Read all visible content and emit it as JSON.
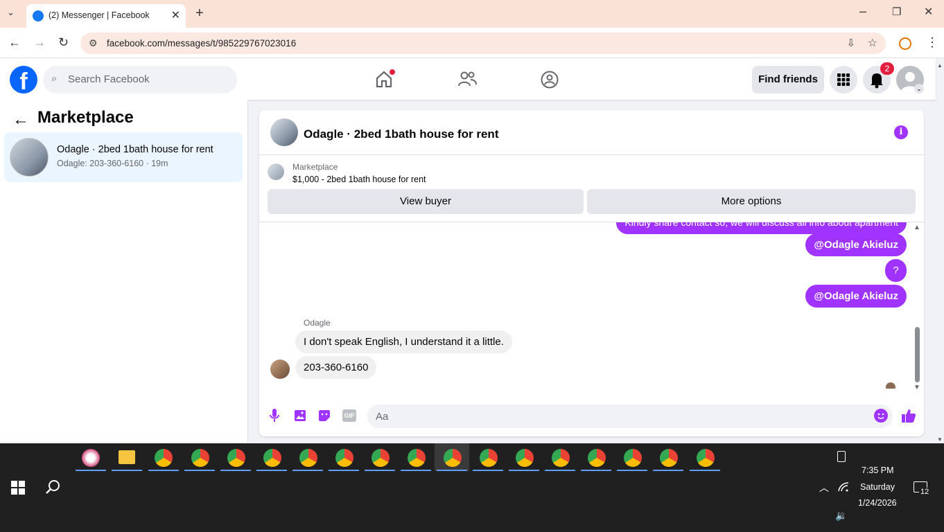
{
  "browser": {
    "tab_title": "(2) Messenger | Facebook",
    "url": "facebook.com/messages/t/985229767023016"
  },
  "header": {
    "search_placeholder": "Search Facebook",
    "find_friends": "Find friends",
    "notification_count": "2"
  },
  "left_panel": {
    "title": "Marketplace",
    "conversation": {
      "name": "Odagle · 2bed 1bath house for rent",
      "preview": "Odagle: 203-360-6160 · 19m"
    }
  },
  "chat": {
    "title": "Odagle · 2bed 1bath house for rent",
    "marketplace_label": "Marketplace",
    "listing": "$1,000 - 2bed 1bath house for rent",
    "view_buyer": "View buyer",
    "more_options": "More options",
    "outgoing": [
      "Kindly share contact so, we will discuss all info about apartment",
      "@Odagle Akieluz",
      "?",
      "@Odagle Akieluz"
    ],
    "sender_name": "Odagle",
    "incoming": [
      "I don't speak English, I understand it a little.",
      "203-360-6160"
    ],
    "compose_placeholder": "Aa"
  },
  "taskbar": {
    "time": "7:35 PM",
    "day": "Saturday",
    "date": "1/24/2026",
    "notification_count": "12"
  },
  "colors": {
    "accent_purple": "#a033ff",
    "facebook_blue": "#0866ff",
    "notification_red": "#e41e3f"
  }
}
